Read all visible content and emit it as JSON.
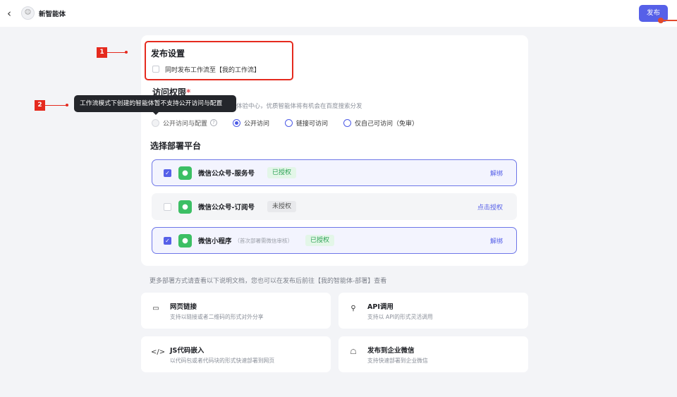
{
  "header": {
    "back_icon": "chevron-left-icon",
    "avatar_icon": "agent-avatar-icon",
    "avatar_glyph": "☺",
    "agent_name": "新智能体",
    "publish_label": "发布"
  },
  "annotations": {
    "marker_1": "1",
    "marker_2": "2",
    "color": "#e52a1e"
  },
  "publish_settings": {
    "title": "发布设置",
    "sync_label": "同时发布工作流至【我的工作流】",
    "sync_checked": false
  },
  "access": {
    "title": "访问权限",
    "required_mark": "*",
    "desc_visible": "体验中心，优质智能体将有机会在百度搜索分发",
    "tooltip": "工作流模式下创建的智能体暂不支持公开访问与配置",
    "options": [
      {
        "label": "公开访问与配置",
        "state": "disabled",
        "help": "?"
      },
      {
        "label": "公开访问",
        "state": "selected"
      },
      {
        "label": "链接可访问",
        "state": "unselected"
      },
      {
        "label": "仅自己可访问（免审）",
        "state": "unselected"
      }
    ]
  },
  "platforms": {
    "title": "选择部署平台",
    "items": [
      {
        "name": "微信公众号-服务号",
        "note": "",
        "status": "已授权",
        "action": "解绑",
        "checked": true
      },
      {
        "name": "微信公众号-订阅号",
        "note": "",
        "status": "未授权",
        "action": "点击授权",
        "checked": false
      },
      {
        "name": "微信小程序",
        "note": "（首次部署需微信审核）",
        "status": "已授权",
        "action": "解绑",
        "checked": true
      }
    ]
  },
  "more_docs": "更多部署方式请查看以下说明文档，您也可以在发布后前往【我的智能体-部署】查看",
  "docs": [
    {
      "icon": "web-link-icon",
      "glyph": "▭",
      "title": "网页链接",
      "desc": "支持以链接或者二维码的形式对外分享"
    },
    {
      "icon": "api-icon",
      "glyph": "⚲",
      "title": "API调用",
      "desc": "支持以 API的形式灵活调用"
    },
    {
      "icon": "code-icon",
      "glyph": "</>",
      "title": "JS代码嵌入",
      "desc": "以代码包或者代码块的形式快速部署到网页"
    },
    {
      "icon": "robot-icon",
      "glyph": "☖",
      "title": "发布到企业微信",
      "desc": "支持快速部署到企业微信"
    }
  ],
  "colors": {
    "accent": "#5660e8",
    "authorized": "#2ea356",
    "wechat": "#3cbf64"
  }
}
